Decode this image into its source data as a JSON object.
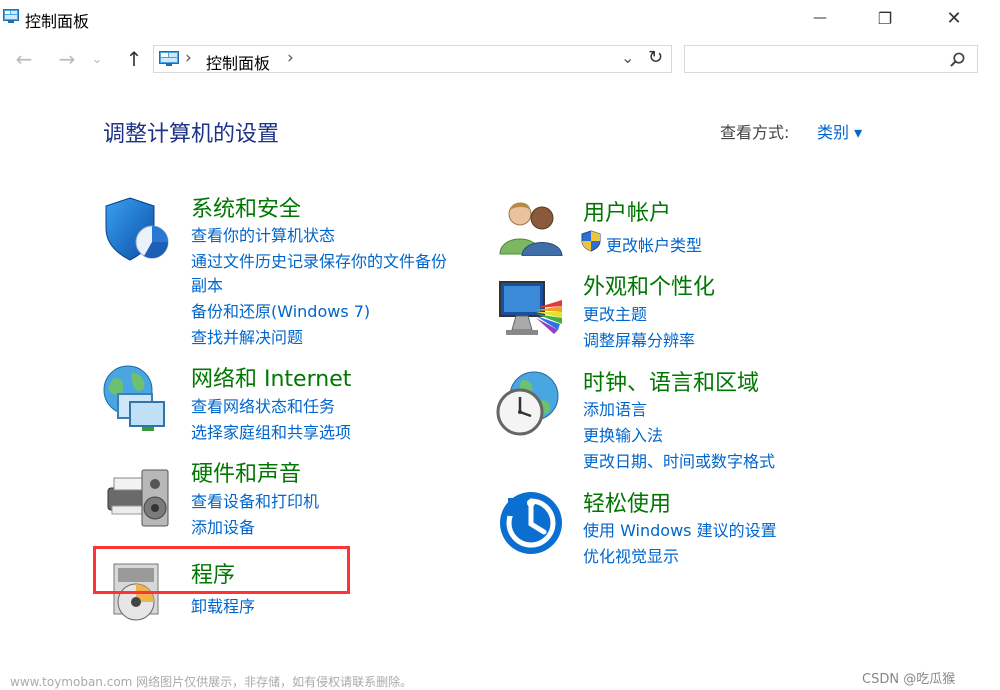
{
  "window": {
    "title": "控制面板",
    "minimize_glyph": "—",
    "maximize_glyph": "❐",
    "close_glyph": "✕"
  },
  "nav": {
    "back_glyph": "←",
    "forward_glyph": "→",
    "recent_glyph": "⌄",
    "up_glyph": "↑"
  },
  "address": {
    "breadcrumb_sep": "›",
    "location": "控制面板",
    "location_sep": "›",
    "refresh_glyph": "↻"
  },
  "search": {
    "value": "",
    "placeholder": ""
  },
  "header": {
    "title": "调整计算机的设置",
    "view_by_label": "查看方式:",
    "view_by_value": "类别 ▾"
  },
  "categories": {
    "system": {
      "title": "系统和安全",
      "links": [
        "查看你的计算机状态",
        "通过文件历史记录保存你的文件备份",
        "副本",
        "备份和还原(Windows 7)",
        "查找并解决问题"
      ]
    },
    "network": {
      "title": "网络和 Internet",
      "links": [
        "查看网络状态和任务",
        "选择家庭组和共享选项"
      ]
    },
    "hardware": {
      "title": "硬件和声音",
      "links": [
        "查看设备和打印机",
        "添加设备"
      ]
    },
    "programs": {
      "title": "程序",
      "links": [
        "卸载程序"
      ]
    },
    "accounts": {
      "title": "用户帐户",
      "links": [
        "更改帐户类型"
      ]
    },
    "appearance": {
      "title": "外观和个性化",
      "links": [
        "更改主题",
        "调整屏幕分辨率"
      ]
    },
    "clock": {
      "title": "时钟、语言和区域",
      "links": [
        "添加语言",
        "更换输入法",
        "更改日期、时间或数字格式"
      ]
    },
    "ease": {
      "title": "轻松使用",
      "links": [
        "使用 Windows 建议的设置",
        "优化视觉显示"
      ]
    }
  },
  "watermark": "www.toymoban.com 网络图片仅供展示，非存储，如有侵权请联系删除。",
  "csdn_mark": "CSDN @吃瓜猴",
  "colors": {
    "heading": "#1e3287",
    "category_title": "#007700",
    "link": "#0066cc",
    "highlight_border": "#ff3333"
  }
}
